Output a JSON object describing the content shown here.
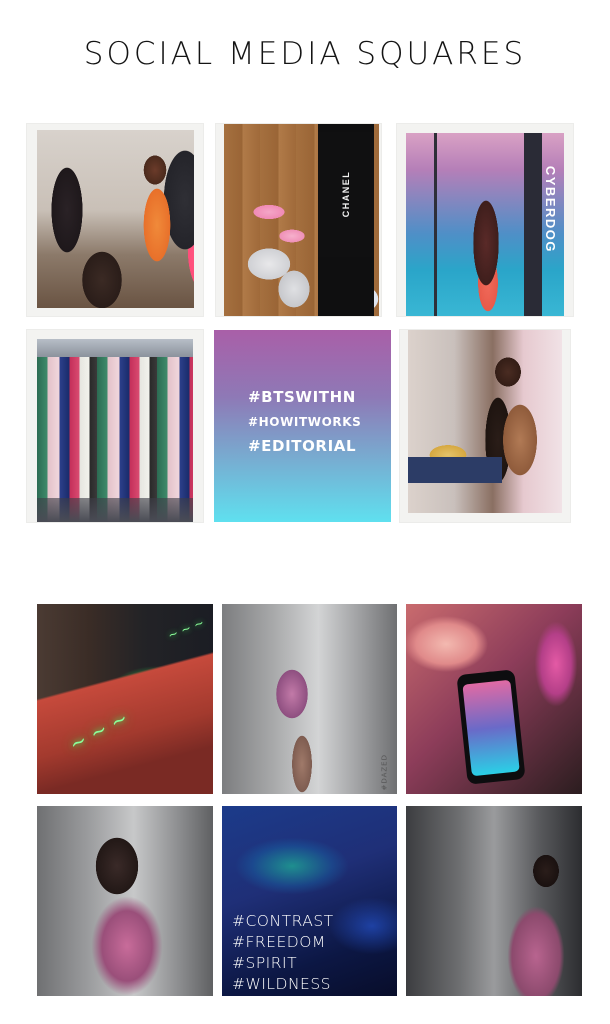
{
  "header": {
    "title": "SOCIAL MEDIA SQUARES"
  },
  "top_grid": {
    "bag_label": "CHANEL",
    "brand_label": "CYBERDOG",
    "hashtags": [
      "#BTSWITHN",
      "#HOWITWORKS",
      "#EDITORIAL"
    ]
  },
  "bottom_grid": {
    "watermark": "#DAZED",
    "hashtags": [
      "#CONTRAST",
      "#FREEDOM",
      "#SPIRIT",
      "#WILDNESS"
    ]
  },
  "colors": {
    "gradient_top": "#a95fa8",
    "gradient_bottom": "#5fe0ef",
    "space_bg": "#1c3b8a"
  }
}
